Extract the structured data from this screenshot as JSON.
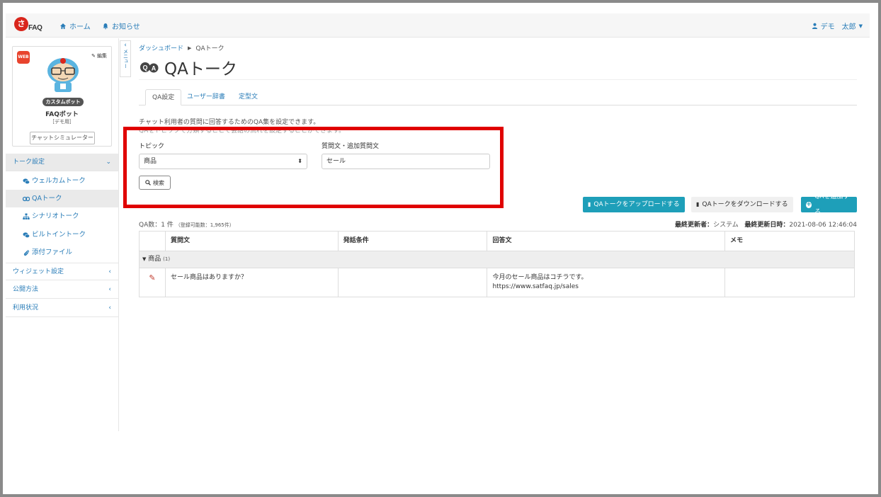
{
  "navbar": {
    "logo_text": "FAQ",
    "logo_mark": "さ",
    "home": "ホーム",
    "news": "お知らせ",
    "user": "デモ　太郎"
  },
  "bot": {
    "web_badge": "WEB",
    "edit": "編集",
    "tag": "カスタムボット",
    "name": "FAQボット",
    "sub": "［デモ用］",
    "simulator": "チャットシミュレーター"
  },
  "sidebar": {
    "collapse_label": "メニュー",
    "sections": [
      {
        "label": "トーク設定"
      },
      {
        "label": "ウィジェット設定"
      },
      {
        "label": "公開方法"
      },
      {
        "label": "利用状況"
      }
    ],
    "items": [
      {
        "label": "ウェルカムトーク",
        "icon": "comments-icon"
      },
      {
        "label": "QAトーク",
        "icon": "qa-icon"
      },
      {
        "label": "シナリオトーク",
        "icon": "sitemap-icon"
      },
      {
        "label": "ビルトイントーク",
        "icon": "comments-icon"
      },
      {
        "label": "添付ファイル",
        "icon": "paperclip-icon"
      }
    ]
  },
  "main": {
    "breadcrumb": [
      "ダッシュボード",
      "QAトーク"
    ],
    "title": "QAトーク",
    "tabs": [
      "QA設定",
      "ユーザー辞書",
      "定型文"
    ],
    "description": "チャット利用者の質問に回答するためのQA集を設定できます。",
    "description2": "QAをトピックで分類することで会話の流れを設定することができます。",
    "topic_label": "トピック",
    "topic_value": "商品",
    "question_label": "質問文・追加質問文",
    "question_value": "セール",
    "search": "検索",
    "upload": "QAトークをアップロードする",
    "download": "QAトークをダウンロードする",
    "add": "QAを追加する",
    "count_text": "QA数：1 件",
    "count_sub": "（登録可能数：1,965件）",
    "updated_by_label": "最終更新者：",
    "updated_by": "システム",
    "updated_at_label": "最終更新日時：",
    "updated_at": "2021-08-06 12:46:04"
  },
  "table": {
    "headers": [
      "質問文",
      "発話条件",
      "回答文",
      "メモ"
    ],
    "group": "商品",
    "group_count": "(1)",
    "rows": [
      {
        "question": "セール商品はありますか？",
        "condition": "",
        "answer_line1": "今月のセール商品はコチラです。",
        "answer_line2": "https://www.satfaq.jp/sales",
        "memo": ""
      }
    ]
  },
  "colors": {
    "accent": "#2a7db8",
    "teal_button": "#1e9fb9",
    "highlight": "#e00000",
    "brand_red": "#d9261c"
  }
}
